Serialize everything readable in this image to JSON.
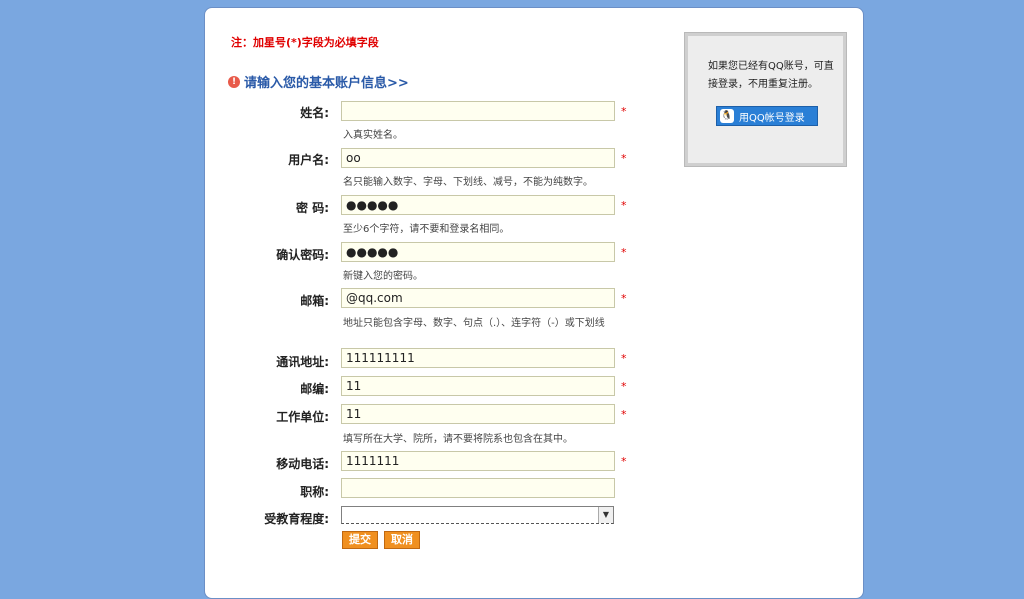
{
  "note": "注：加星号(*)字段为必填字段",
  "section_title": "请输入您的基本账户信息>>",
  "required_mark": "*",
  "fields": {
    "name": {
      "label": "姓名:",
      "value": "",
      "hint": "入真实姓名。"
    },
    "username": {
      "label": "用户名:",
      "value": "oo",
      "hint": "名只能输入数字、字母、下划线、减号，不能为纯数字。"
    },
    "password": {
      "label": "密  码:",
      "value": "●●●●●",
      "hint": "至少6个字符，请不要和登录名相同。"
    },
    "confirm": {
      "label": "确认密码:",
      "value": "●●●●●",
      "hint": "新键入您的密码。"
    },
    "email": {
      "label": "邮箱:",
      "value": "@qq.com",
      "hint": "地址只能包含字母、数字、句点（.）、连字符（-）或下划线"
    },
    "address": {
      "label": "通讯地址:",
      "value": "111111111"
    },
    "zip": {
      "label": "邮编:",
      "value": "11"
    },
    "work": {
      "label": "工作单位:",
      "value": "11",
      "hint": "填写所在大学、院所，请不要将院系也包含在其中。"
    },
    "mobile": {
      "label": "移动电话:",
      "value": "1111111"
    },
    "title": {
      "label": "职称:",
      "value": ""
    },
    "education": {
      "label": "受教育程度:",
      "value": ""
    }
  },
  "buttons": {
    "submit": "提交",
    "cancel": "取消"
  },
  "qq": {
    "text": "如果您已经有QQ账号，可直接登录，不用重复注册。",
    "button": "用QQ帐号登录"
  }
}
